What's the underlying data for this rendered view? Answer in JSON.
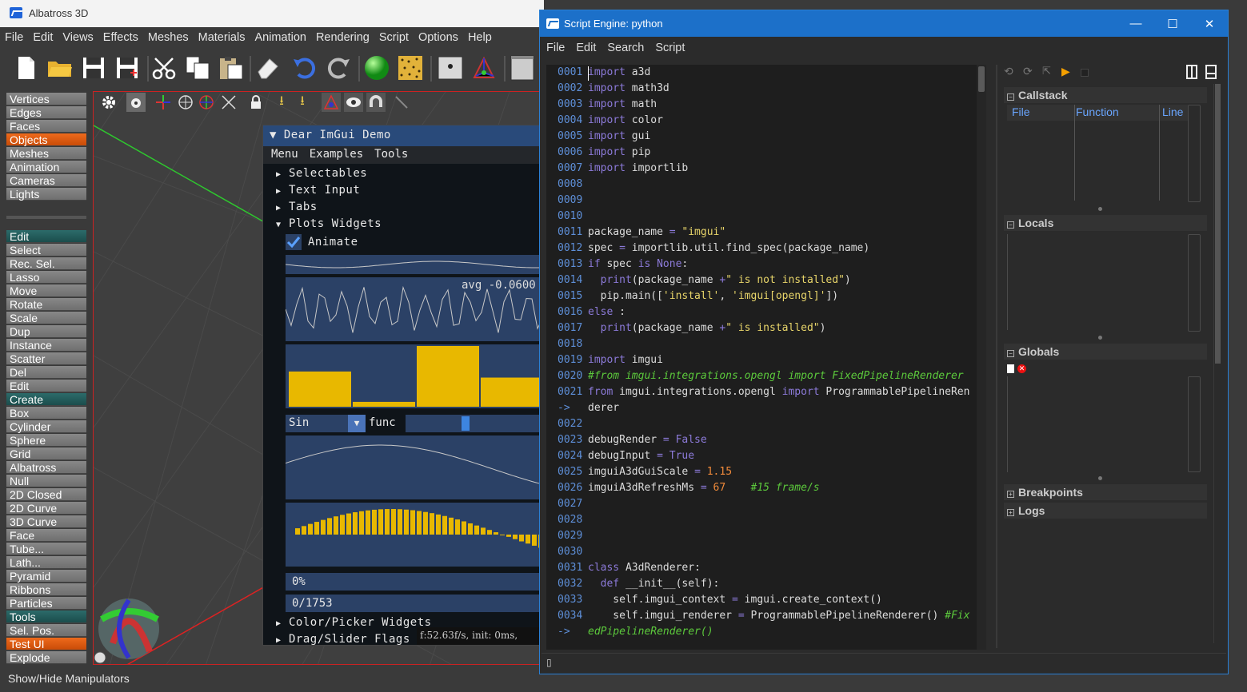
{
  "main_window": {
    "title": "Albatross 3D",
    "menu": [
      "File",
      "Edit",
      "Views",
      "Effects",
      "Meshes",
      "Materials",
      "Animation",
      "Rendering",
      "Script",
      "Options",
      "Help"
    ],
    "status": "Show/Hide Manipulators"
  },
  "sidebar": {
    "views": [
      "Vertices",
      "Edges",
      "Faces",
      "Objects",
      "Meshes",
      "Animation",
      "Cameras",
      "Lights"
    ],
    "edit_header": "Edit",
    "edit": [
      "Select",
      "Rec. Sel.",
      "Lasso",
      "Move",
      "Rotate",
      "Scale",
      "Dup",
      "Instance",
      "Scatter",
      "Del",
      "Edit"
    ],
    "create_header": "Create",
    "create": [
      "Box",
      "Cylinder",
      "Sphere",
      "Grid",
      "Albatross",
      "Null",
      "2D Closed",
      "2D Curve",
      "3D Curve",
      "Face",
      "Tube...",
      "Lath...",
      "Pyramid",
      "Ribbons",
      "Particles"
    ],
    "tools_header": "Tools",
    "tools": [
      "Sel. Pos.",
      "Test UI",
      "Explode"
    ],
    "active": [
      "Objects",
      "Test UI"
    ]
  },
  "imgui": {
    "title": "Dear ImGui Demo",
    "menu": [
      "Menu",
      "Examples",
      "Tools"
    ],
    "tree": [
      "Selectables",
      "Text Input",
      "Tabs",
      "Plots Widgets"
    ],
    "animate_label": "Animate",
    "avg_label": "avg -0.0600",
    "combo_value": "Sin",
    "combo_label": "func",
    "progress1": "0%",
    "progress2": "0/1753",
    "tree2": [
      "Color/Picker Widgets",
      "Drag/Slider Flags"
    ],
    "fps": "f:52.63f/s, init: 0ms,",
    "bars1": [
      0.58,
      0.08,
      1.0,
      0.48
    ],
    "animate_checked": true
  },
  "script_window": {
    "title": "Script Engine: python",
    "menu": [
      "File",
      "Edit",
      "Search",
      "Script"
    ],
    "sections": {
      "callstack": "Callstack",
      "locals": "Locals",
      "globals": "Globals",
      "breakpoints": "Breakpoints",
      "logs": "Logs"
    },
    "callstack_columns": [
      "File",
      "Function",
      "Line"
    ]
  },
  "code_lines": [
    {
      "n": "0001",
      "html": "<span class='kw'>import</span> a3d"
    },
    {
      "n": "0002",
      "html": "<span class='kw'>import</span> math3d"
    },
    {
      "n": "0003",
      "html": "<span class='kw'>import</span> math"
    },
    {
      "n": "0004",
      "html": "<span class='kw'>import</span> color"
    },
    {
      "n": "0005",
      "html": "<span class='kw'>import</span> gui"
    },
    {
      "n": "0006",
      "html": "<span class='kw'>import</span> pip"
    },
    {
      "n": "0007",
      "html": "<span class='kw'>import</span> importlib"
    },
    {
      "n": "0008",
      "html": ""
    },
    {
      "n": "0009",
      "html": ""
    },
    {
      "n": "0010",
      "html": ""
    },
    {
      "n": "0011",
      "html": "package_name <span class='kw'>=</span> <span class='str'>\"imgui\"</span>"
    },
    {
      "n": "0012",
      "html": "spec <span class='kw'>=</span> importlib.util.find_spec(package_name)"
    },
    {
      "n": "0013",
      "html": "<span class='kw'>if</span> spec <span class='kw'>is</span> <span class='kw'>None</span>:"
    },
    {
      "n": "0014",
      "html": "  <span class='kw'>print</span>(package_name <span class='kw'>+</span><span class='str'>\" is not installed\"</span>)"
    },
    {
      "n": "0015",
      "html": "  pip.main([<span class='str'>'install'</span>, <span class='str'>'imgui[opengl]'</span>])"
    },
    {
      "n": "0016",
      "html": "<span class='kw'>else</span> :"
    },
    {
      "n": "0017",
      "html": "  <span class='kw'>print</span>(package_name <span class='kw'>+</span><span class='str'>\" is installed\"</span>)"
    },
    {
      "n": "0018",
      "html": ""
    },
    {
      "n": "0019",
      "html": "<span class='kw'>import</span> imgui"
    },
    {
      "n": "0020",
      "html": "<span class='cmt'>#from imgui.integrations.opengl import FixedPipelineRenderer</span>"
    },
    {
      "n": "0021",
      "html": "<span class='kw'>from</span> imgui.integrations.opengl <span class='kw'>import</span> ProgrammablePipelineRen"
    },
    {
      "n": "  ->",
      "html": "derer"
    },
    {
      "n": "0022",
      "html": ""
    },
    {
      "n": "0023",
      "html": "debugRender <span class='kw'>=</span> <span class='kw'>False</span>"
    },
    {
      "n": "0024",
      "html": "debugInput <span class='kw'>=</span> <span class='kw'>True</span>"
    },
    {
      "n": "0025",
      "html": "imguiA3dGuiScale <span class='kw'>=</span> <span class='num'>1.15</span>"
    },
    {
      "n": "0026",
      "html": "imguiA3dRefreshMs <span class='kw'>=</span> <span class='num'>67</span>    <span class='cmt'>#15 frame/s</span>"
    },
    {
      "n": "0027",
      "html": ""
    },
    {
      "n": "0028",
      "html": ""
    },
    {
      "n": "0029",
      "html": ""
    },
    {
      "n": "0030",
      "html": ""
    },
    {
      "n": "0031",
      "html": "<span class='kw'>class</span> A3dRenderer:"
    },
    {
      "n": "0032",
      "html": "  <span class='kw'>def</span> __init__(self):"
    },
    {
      "n": "0033",
      "html": "    self.imgui_context <span class='kw'>=</span> imgui.create_context()"
    },
    {
      "n": "0034",
      "html": "    self.imgui_renderer <span class='kw'>=</span> ProgrammablePipelineRenderer() <span class='cmt'>#Fix</span>"
    },
    {
      "n": "  ->",
      "html": "<span class='cmt'>edPipelineRenderer()</span>"
    }
  ],
  "colors": {
    "accent_blue": "#1c70c9",
    "active_orange": "#e0601a",
    "header_teal": "#2c6b6a",
    "plot_yellow": "#e8b800"
  }
}
